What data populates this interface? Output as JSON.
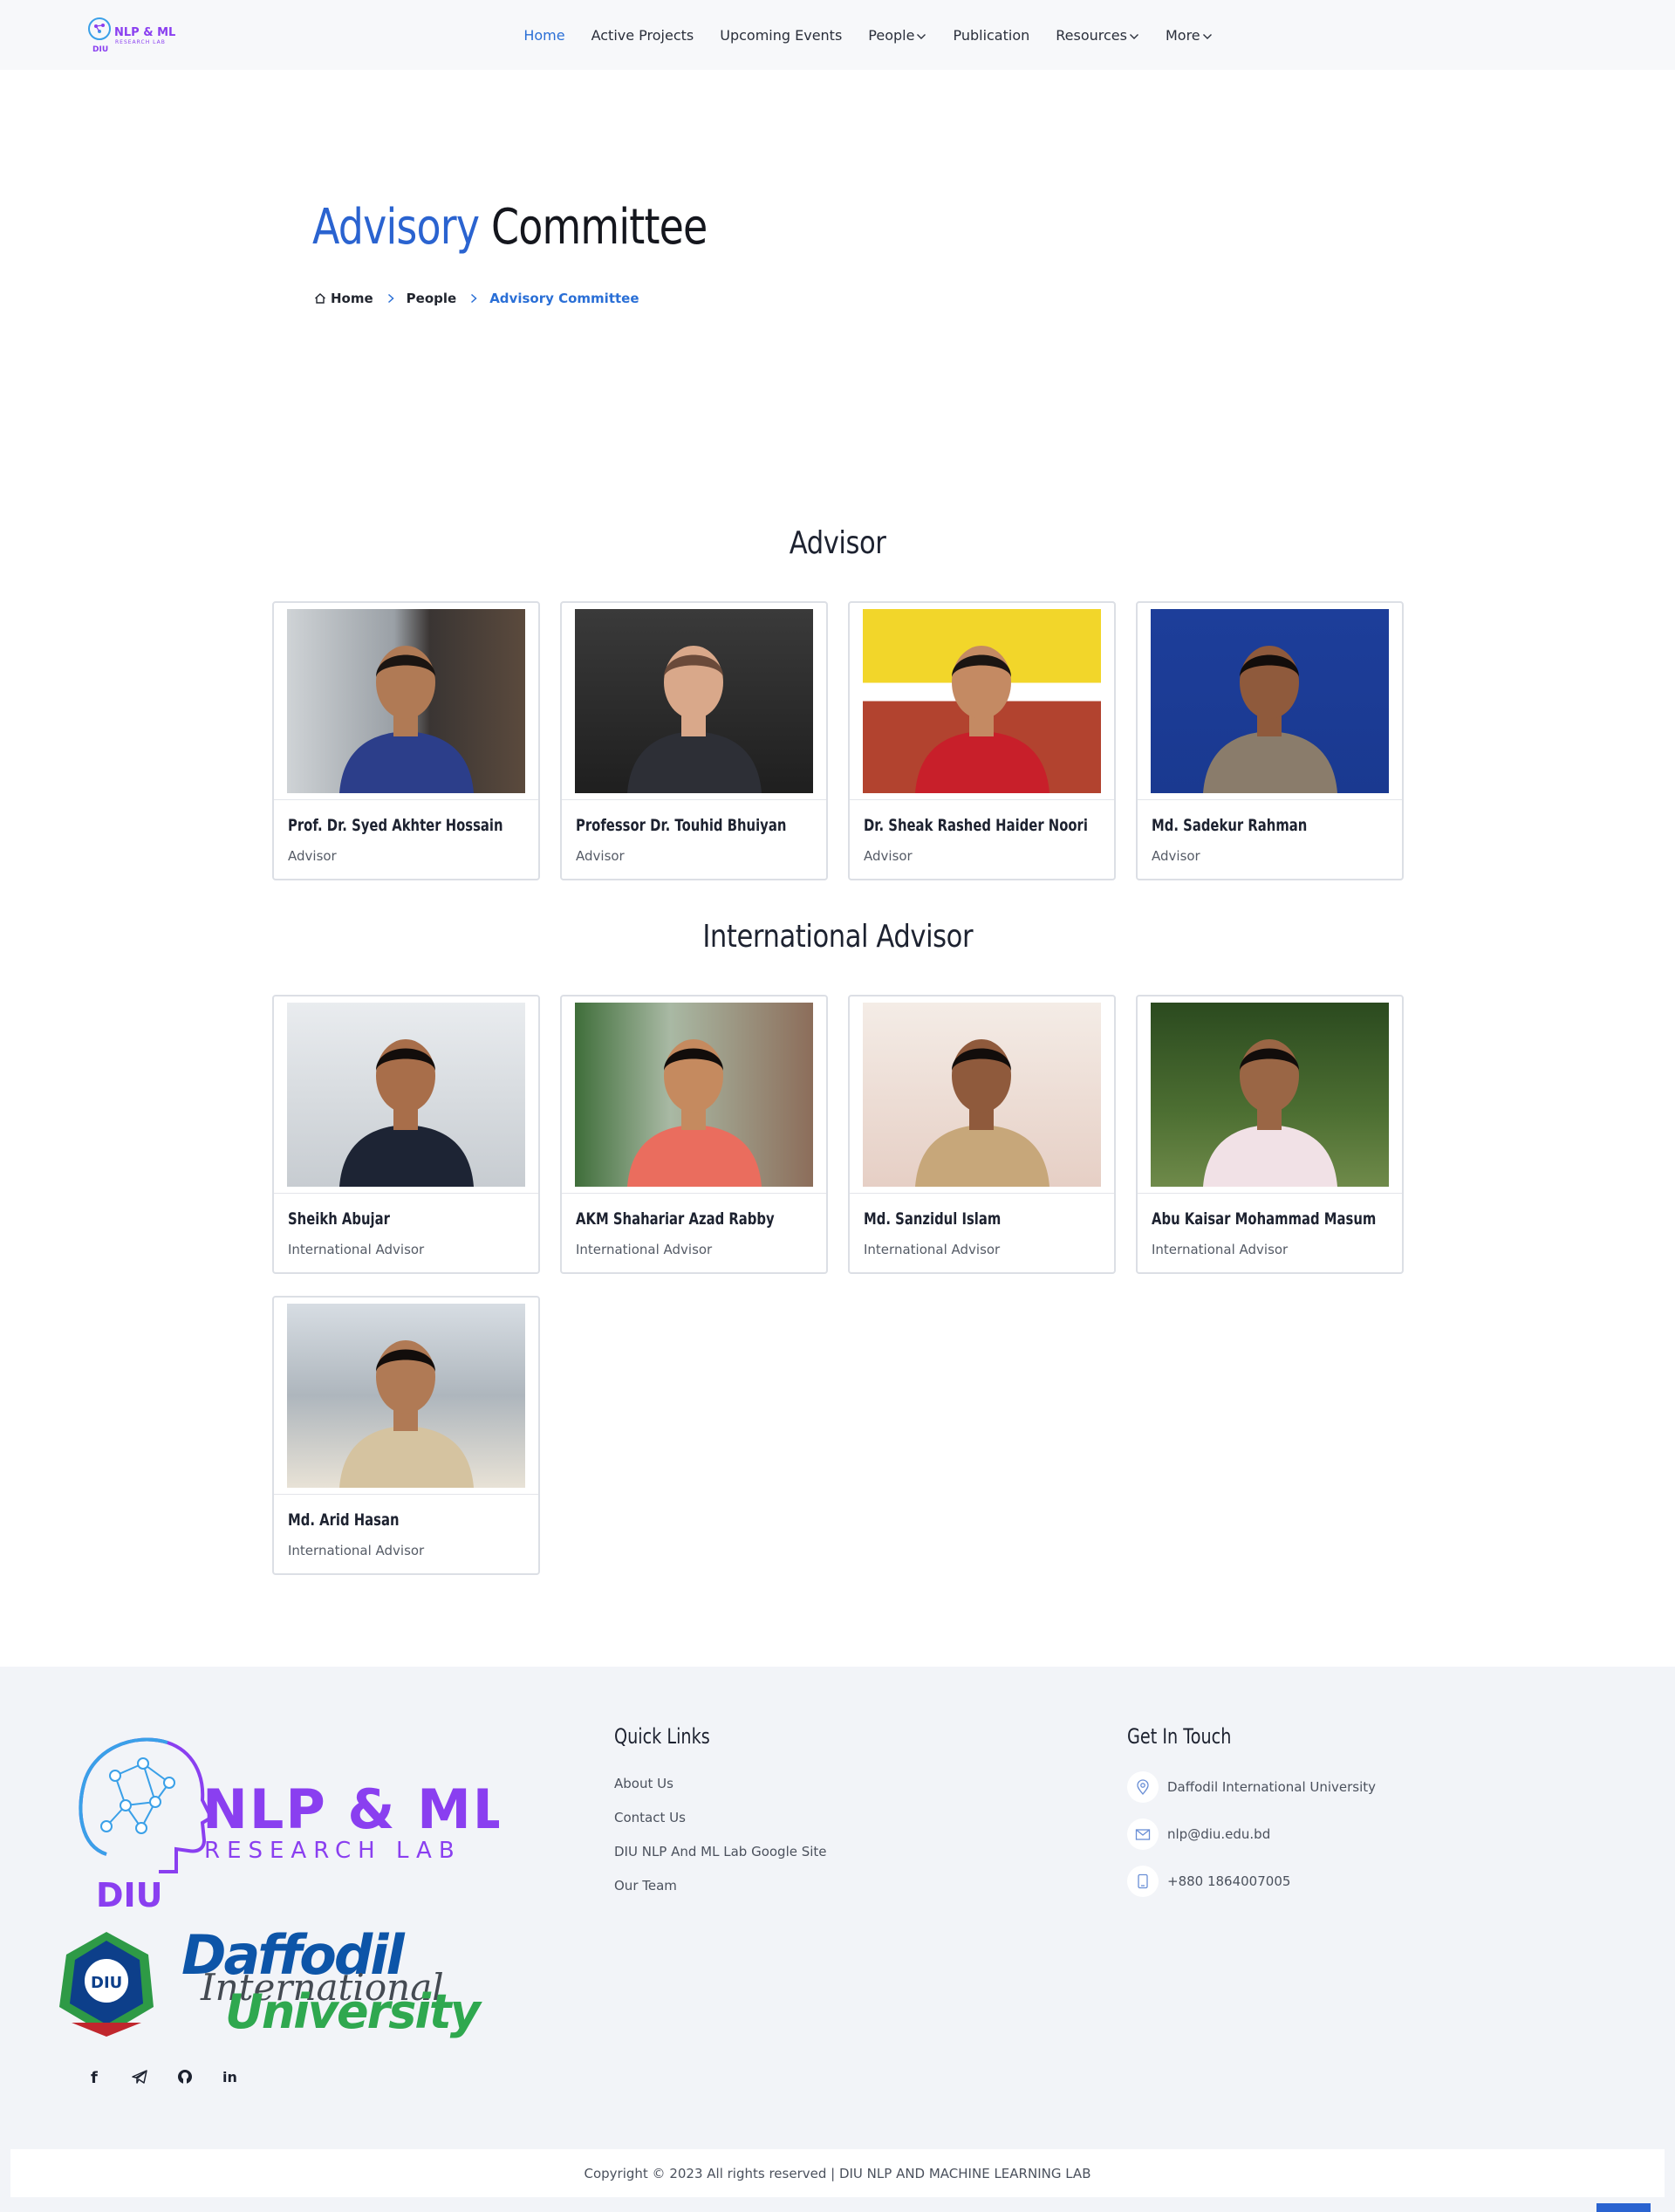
{
  "header": {
    "logo_text": "NLP & ML",
    "logo_subtext": "RESEARCH LAB",
    "logo_diu": "DIU",
    "nav": [
      {
        "label": "Home",
        "active": true,
        "dropdown": false
      },
      {
        "label": "Active Projects",
        "active": false,
        "dropdown": false
      },
      {
        "label": "Upcoming Events",
        "active": false,
        "dropdown": false
      },
      {
        "label": "People",
        "active": false,
        "dropdown": true
      },
      {
        "label": "Publication",
        "active": false,
        "dropdown": false
      },
      {
        "label": "Resources",
        "active": false,
        "dropdown": true
      },
      {
        "label": "More",
        "active": false,
        "dropdown": true
      }
    ]
  },
  "title": {
    "accent": "Advisory",
    "rest": " Committee"
  },
  "breadcrumb": {
    "home": "Home",
    "people": "People",
    "current": "Advisory Committee"
  },
  "sections": [
    {
      "heading": "Advisor",
      "members": [
        {
          "name": "Prof. Dr. Syed Akhter Hossain",
          "role": "Advisor"
        },
        {
          "name": "Professor Dr. Touhid Bhuiyan",
          "role": "Advisor"
        },
        {
          "name": "Dr. Sheak Rashed Haider Noori",
          "role": "Advisor"
        },
        {
          "name": "Md. Sadekur Rahman",
          "role": "Advisor"
        }
      ]
    },
    {
      "heading": "International Advisor",
      "members": [
        {
          "name": "Sheikh Abujar",
          "role": "International Advisor"
        },
        {
          "name": "AKM Shahariar Azad Rabby",
          "role": "International Advisor"
        },
        {
          "name": "Md. Sanzidul Islam",
          "role": "International Advisor"
        },
        {
          "name": "Abu Kaisar Mohammad Masum",
          "role": "International Advisor"
        },
        {
          "name": "Md. Arid Hasan",
          "role": "International Advisor"
        }
      ]
    }
  ],
  "footer": {
    "logo_title": "NLP & ML",
    "logo_sub": "RESEARCH LAB",
    "logo_diu": "DIU",
    "university_line1": "Daffodil",
    "university_line2": "International",
    "university_line3": "University",
    "quick_links_title": "Quick Links",
    "quick_links": [
      "About Us",
      "Contact Us",
      "DIU NLP And ML Lab Google Site",
      "Our Team"
    ],
    "contact_title": "Get In Touch",
    "contacts": [
      {
        "icon": "location-icon",
        "text": "Daffodil International University"
      },
      {
        "icon": "email-icon",
        "text": "nlp@diu.edu.bd"
      },
      {
        "icon": "phone-icon",
        "text": "+880 1864007005"
      }
    ],
    "social": [
      "facebook-icon",
      "telegram-icon",
      "github-icon",
      "linkedin-icon"
    ],
    "social_labels": {
      "facebook": "f",
      "linkedin": "in"
    },
    "copyright": "Copyright © 2023 All rights reserved | DIU NLP AND MACHINE LEARNING LAB"
  },
  "colors": {
    "accent": "#2a63d0",
    "logo_purple": "#8a3ff0",
    "logo_blue": "#3aa0e8",
    "footer_bg": "#f2f4f8"
  }
}
